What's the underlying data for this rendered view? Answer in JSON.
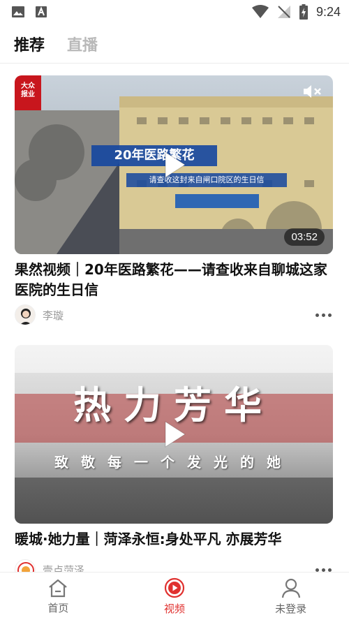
{
  "status_bar": {
    "time": "9:24",
    "left_icons": [
      "image-icon",
      "text-a-icon"
    ],
    "right_icons": [
      "wifi-icon",
      "no-signal-icon",
      "battery-charging-icon"
    ]
  },
  "tabs": [
    {
      "label": "推荐",
      "active": true
    },
    {
      "label": "直播",
      "active": false
    }
  ],
  "feed": [
    {
      "title": "果然视频｜20年医路繁花——请查收来自聊城这家医院的生日信",
      "author": "李璇",
      "duration": "03:52",
      "overlay_title": "20年医路繁花",
      "overlay_subtitle": "请查收这封来自闸口院区的生日信",
      "logo_text": "大众报业"
    },
    {
      "title": "暖城·她力量｜菏泽永恒:身处平凡 亦展芳华",
      "author": "壹点菏泽",
      "overlay_title": "热力芳华",
      "overlay_subtitle": "致敬每一个发光的她"
    }
  ],
  "bottom_nav": [
    {
      "label": "首页",
      "icon": "home-icon",
      "active": false
    },
    {
      "label": "视频",
      "icon": "video-play-icon",
      "active": true
    },
    {
      "label": "未登录",
      "icon": "user-icon",
      "active": false
    }
  ],
  "colors": {
    "accent": "#e0312f",
    "inactive_tab": "#b9b9b9"
  }
}
